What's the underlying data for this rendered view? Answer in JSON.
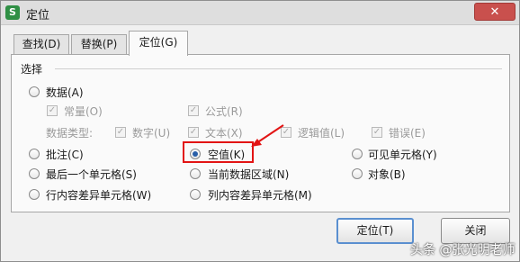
{
  "window": {
    "title": "定位",
    "app_icon": "S",
    "close_glyph": "✕"
  },
  "tabs": [
    {
      "label": "查找(D)"
    },
    {
      "label": "替换(P)"
    },
    {
      "label": "定位(G)",
      "active": true
    }
  ],
  "group": {
    "label": "选择"
  },
  "options": {
    "data": {
      "label": "数据(A)",
      "selected": false
    },
    "constant": {
      "label": "常量(O)",
      "checked": true
    },
    "formula": {
      "label": "公式(R)",
      "checked": true
    },
    "data_type_label": "数据类型:",
    "number": {
      "label": "数字(U)",
      "checked": true
    },
    "text": {
      "label": "文本(X)",
      "checked": true
    },
    "logical": {
      "label": "逻辑值(L)",
      "checked": true
    },
    "error": {
      "label": "错误(E)",
      "checked": true
    },
    "comment": {
      "label": "批注(C)",
      "selected": false
    },
    "blank": {
      "label": "空值(K)",
      "selected": true
    },
    "visible": {
      "label": "可见单元格(Y)",
      "selected": false
    },
    "last_cell": {
      "label": "最后一个单元格(S)",
      "selected": false
    },
    "current_region": {
      "label": "当前数据区域(N)",
      "selected": false
    },
    "objects": {
      "label": "对象(B)",
      "selected": false
    },
    "row_diff": {
      "label": "行内容差异单元格(W)",
      "selected": false
    },
    "col_diff": {
      "label": "列内容差异单元格(M)",
      "selected": false
    }
  },
  "buttons": {
    "locate": "定位(T)",
    "close": "关闭"
  },
  "watermark": "头条 @张光明老师",
  "colors": {
    "annotation": "#e21414",
    "close_button": "#c9504d"
  }
}
